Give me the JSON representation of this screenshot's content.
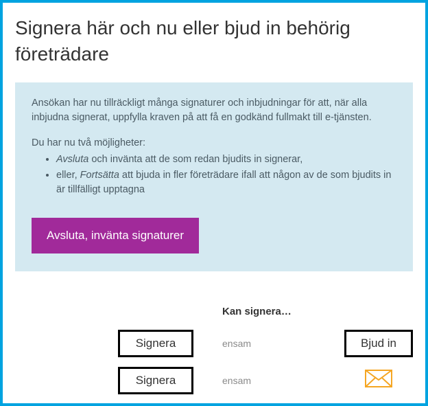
{
  "title": "Signera här och nu eller bjud in behörig företrädare",
  "info": {
    "para1": "Ansökan har nu tillräckligt många signaturer och inbjudningar för att, när alla inbjudna signerat, uppfylla kraven på att få en godkänd fullmakt till e-tjänsten.",
    "optionsHead": "Du har nu två möjligheter:",
    "opt1_em": "Avsluta",
    "opt1_rest": " och invänta att de som redan bjudits in signerar,",
    "opt2_prefix": "eller, ",
    "opt2_em": "Fortsätta",
    "opt2_rest": " att bjuda in fler företrädare ifall att någon av de som bjudits in är tillfälligt upptagna"
  },
  "buttons": {
    "finish": "Avsluta, invänta signaturer",
    "sign": "Signera",
    "invite": "Bjud in"
  },
  "table": {
    "header": "Kan signera…",
    "rows": [
      {
        "status": "ensam",
        "action": "invite"
      },
      {
        "status": "ensam",
        "action": "sent"
      }
    ]
  },
  "colors": {
    "accent": "#00a3e0",
    "primary": "#a12a9a",
    "mail": "#f5a623"
  }
}
